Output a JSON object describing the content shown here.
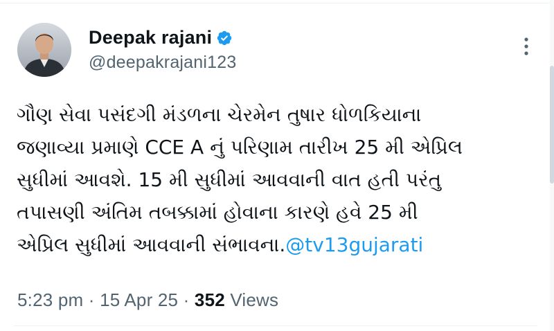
{
  "author": {
    "display_name": "Deepak rajani",
    "handle": "@deepakrajani123",
    "verified_icon": "verified-badge-icon",
    "avatar_icon": "avatar-photo"
  },
  "tweet": {
    "lines": [
      "ગૌણ સેવા પસંદગી મંડળના ચેરમેન તુષાર ધોળકિયાના",
      "જણાવ્યા પ્રમાણે CCE A નું પરિણામ તારીખ 25 મી એપ્રિલ",
      "સુધીમાં આવશે. 15 મી સુધીમાં આવવાની વાત હતી પરંતુ",
      "તપાસણી અંતિમ તબક્કામાં હોવાના કારણે હવે 25 મી",
      "એપ્રિલ સુધીમાં આવવાની સંભાવના."
    ],
    "mention": "@tv13gujarati"
  },
  "meta": {
    "time": "5:23 pm",
    "sep1": " · ",
    "date": "15 Apr 25",
    "sep2": " · ",
    "views_count": "352",
    "views_label": " Views"
  },
  "colors": {
    "accent": "#1d9bf0",
    "text": "#0f1419",
    "secondary": "#536471"
  }
}
